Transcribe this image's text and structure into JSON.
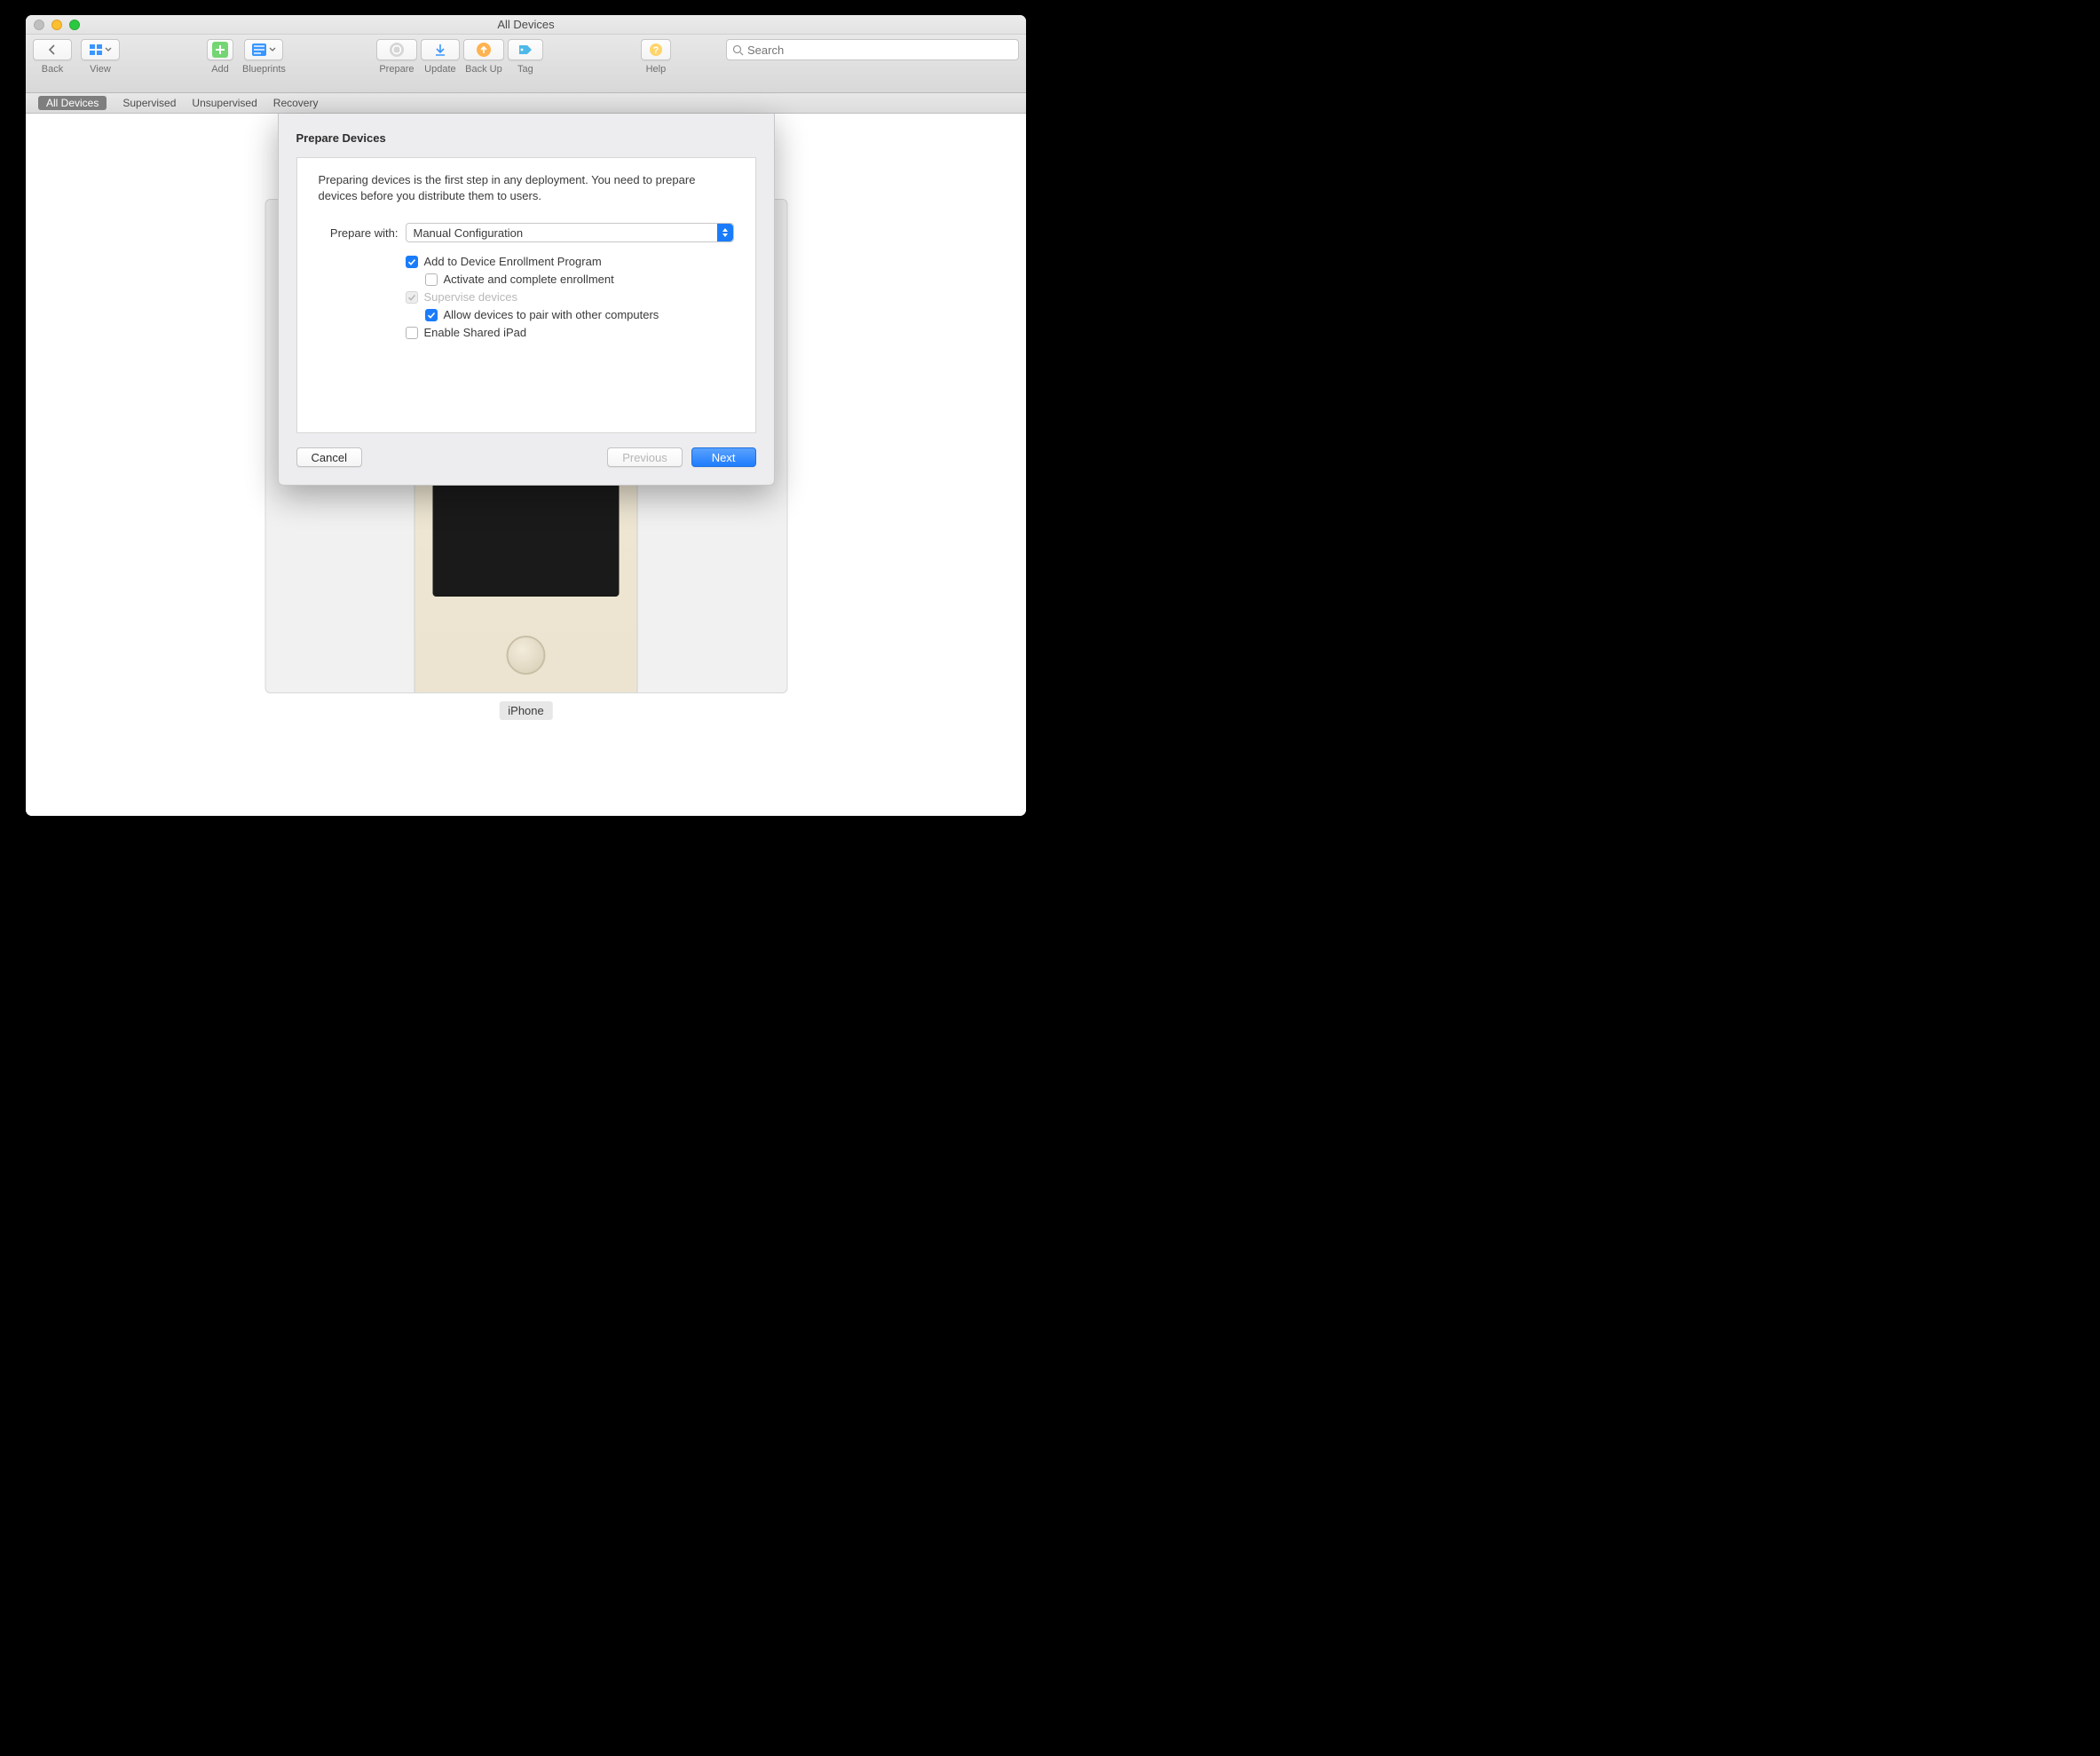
{
  "window": {
    "title": "All Devices"
  },
  "toolbar": {
    "back": {
      "label": "Back"
    },
    "view": {
      "label": "View"
    },
    "add": {
      "label": "Add"
    },
    "blueprints": {
      "label": "Blueprints"
    },
    "prepare": {
      "label": "Prepare"
    },
    "update": {
      "label": "Update"
    },
    "backup": {
      "label": "Back Up"
    },
    "tag": {
      "label": "Tag"
    },
    "help": {
      "label": "Help"
    },
    "search": {
      "placeholder": "Search"
    }
  },
  "filters": {
    "all": "All Devices",
    "supervised": "Supervised",
    "unsupervised": "Unsupervised",
    "recovery": "Recovery",
    "active": "all"
  },
  "device": {
    "label": "iPhone"
  },
  "sheet": {
    "title": "Prepare Devices",
    "intro": "Preparing devices is the first step in any deployment. You need to prepare devices before you distribute them to users.",
    "prepare_with_label": "Prepare with:",
    "prepare_with_value": "Manual Configuration",
    "options": {
      "add_dep": {
        "label": "Add to Device Enrollment Program",
        "checked": true
      },
      "activate": {
        "label": "Activate and complete enrollment",
        "checked": false
      },
      "supervise": {
        "label": "Supervise devices",
        "checked": true,
        "disabled": true
      },
      "pair": {
        "label": "Allow devices to pair with other computers",
        "checked": true
      },
      "shared": {
        "label": "Enable Shared iPad",
        "checked": false
      }
    },
    "buttons": {
      "cancel": "Cancel",
      "previous": "Previous",
      "next": "Next"
    }
  }
}
